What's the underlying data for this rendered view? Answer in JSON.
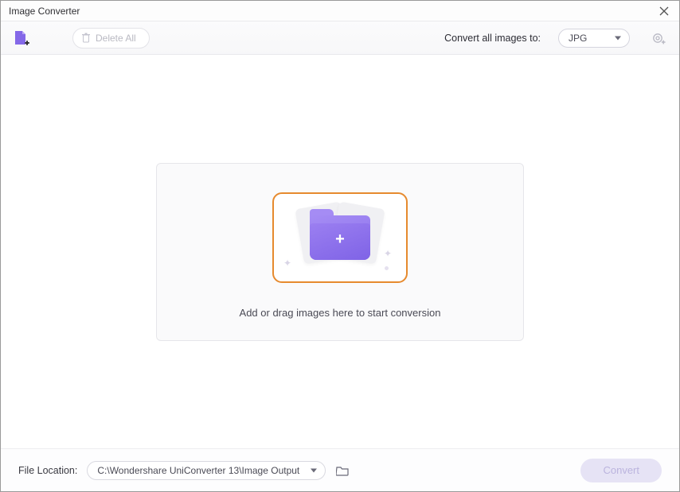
{
  "titlebar": {
    "title": "Image Converter"
  },
  "toolbar": {
    "delete_all_label": "Delete All",
    "convert_all_label": "Convert all images to:",
    "format_selected": "JPG"
  },
  "dropzone": {
    "prompt": "Add or drag images here to start conversion"
  },
  "footer": {
    "location_label": "File Location:",
    "output_path": "C:\\Wondershare UniConverter 13\\Image Output",
    "convert_label": "Convert"
  }
}
